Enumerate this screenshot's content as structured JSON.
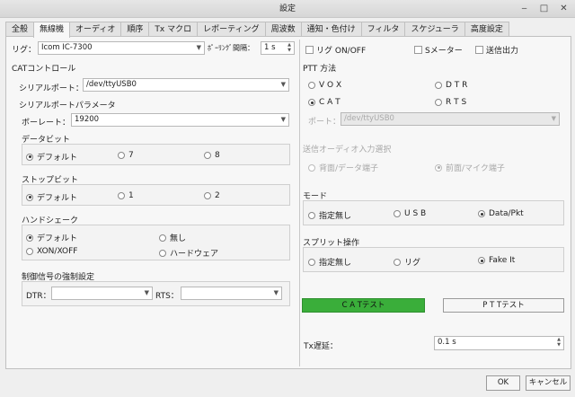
{
  "window": {
    "title": "設定"
  },
  "tabs": [
    "全般",
    "無線機",
    "オーディオ",
    "順序",
    "Tx マクロ",
    "レポーティング",
    "周波数",
    "通知・色付け",
    "フィルタ",
    "スケジューラ",
    "高度設定"
  ],
  "rig": {
    "label": "リグ：",
    "value": "Icom IC-7300",
    "polling_label": "ﾎﾟｰﾘﾝｸﾞ間隔：",
    "polling_value": "1 s",
    "rig_onoff": "リグ ON/OFF",
    "s_meter": "Sメーター",
    "tx_output": "送信出力"
  },
  "cat": {
    "title": "CATコントロール",
    "serial_label": "シリアルポート：",
    "serial_value": "/dev/ttyUSB0",
    "params_title": "シリアルポートパラメータ",
    "baud_label": "ボーレート：",
    "baud_value": "19200",
    "databits_title": "データビット",
    "databits": [
      "デフォルト",
      "7",
      "8"
    ],
    "stopbits_title": "ストップビット",
    "stopbits": [
      "デフォルト",
      "1",
      "2"
    ],
    "handshake_title": "ハンドシェーク",
    "handshake": [
      "デフォルト",
      "無し",
      "XON/XOFF",
      "ハードウェア"
    ],
    "force_title": "制御信号の強制設定",
    "dtr_label": "DTR：",
    "rts_label": "RTS："
  },
  "ptt": {
    "title": "PTT 方法",
    "options": [
      "V O X",
      "D T R",
      "C A T",
      "R T S"
    ],
    "port_label": "ポート：",
    "port_value": "/dev/ttyUSB0"
  },
  "audio_in": {
    "title": "送信オーディオ入力選択",
    "options": [
      "背面/データ端子",
      "前面/マイク端子"
    ]
  },
  "mode": {
    "title": "モード",
    "options": [
      "指定無し",
      "U S B",
      "Data/Pkt"
    ]
  },
  "split": {
    "title": "スプリット操作",
    "options": [
      "指定無し",
      "リグ",
      "Fake It"
    ]
  },
  "buttons": {
    "cat_test": "C A Tテスト",
    "ptt_test": "P T Tテスト",
    "ok": "OK",
    "cancel": "キャンセル"
  },
  "tx_delay": {
    "label": "Tx遅延：",
    "value": "0.1 s"
  },
  "colors": {
    "cat_test_bg": "#3aae3a"
  }
}
